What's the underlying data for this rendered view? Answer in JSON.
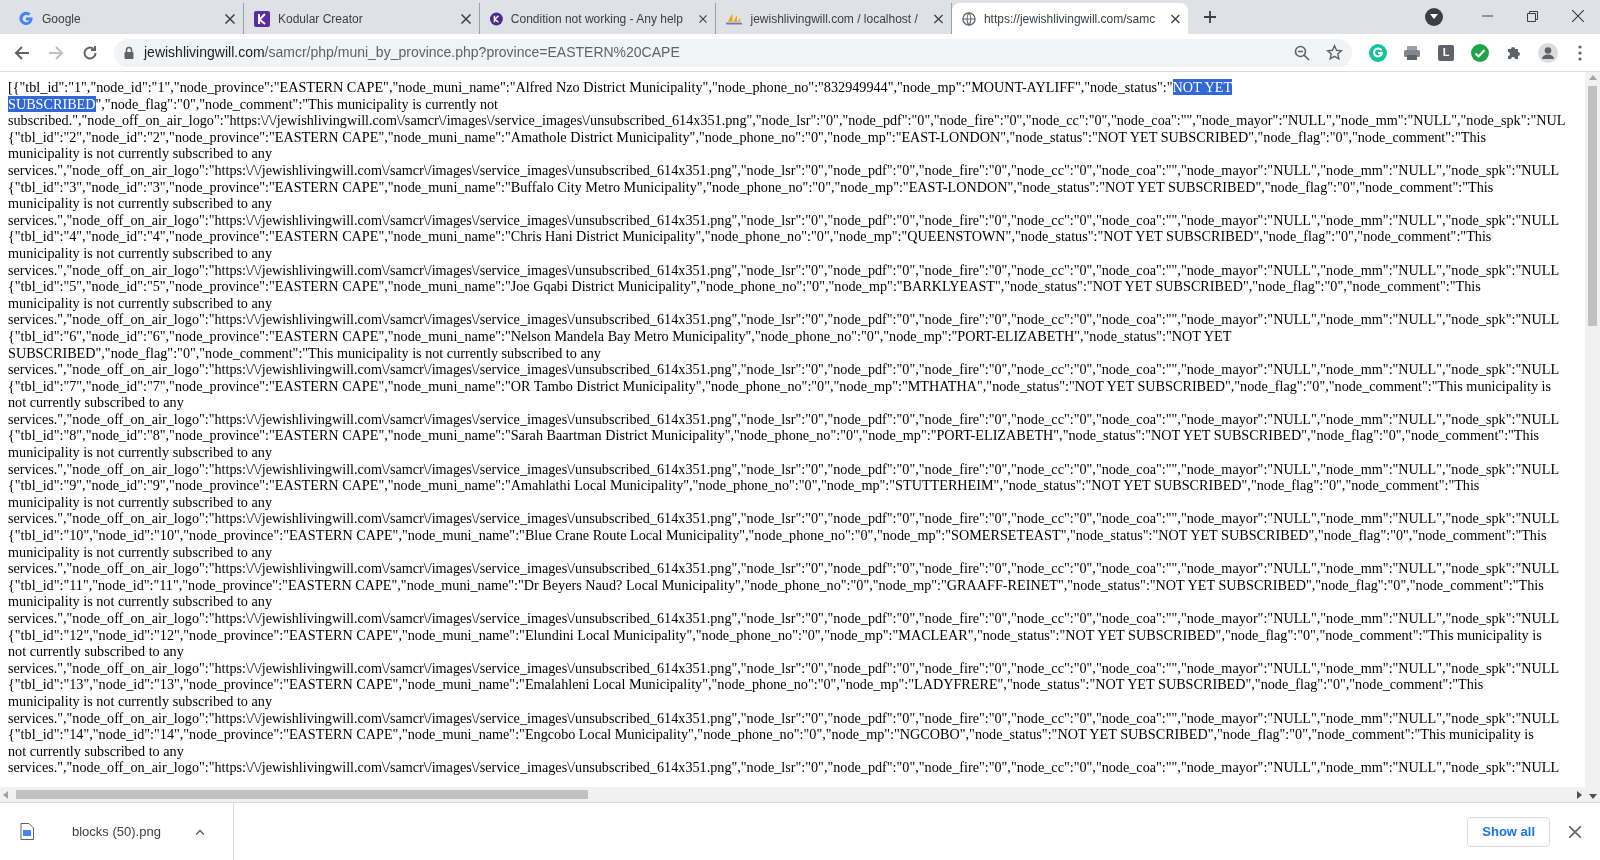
{
  "tabs": [
    {
      "title": "Google",
      "kind": "google",
      "selected": false
    },
    {
      "title": "Kodular Creator",
      "kind": "kodular-square",
      "selected": false
    },
    {
      "title": "Condition not working - Any help",
      "kind": "kodular-circle",
      "selected": false
    },
    {
      "title": "jewishlivingwill.com / localhost /",
      "kind": "pma",
      "selected": false
    },
    {
      "title": "https://jewishlivingwill.com/samc",
      "kind": "globe",
      "selected": true
    }
  ],
  "address_bar": {
    "domain": "jewishlivingwill.com",
    "path": "/samcr/php/muni_by_province.php?province=EASTERN%20CAPE"
  },
  "extension_letter": "L",
  "lines": [
    [
      {
        "text": "[{\"tbl_id\":\"1\",\"node_id\":\"1\",\"node_province\":\"EASTERN CAPE\",\"node_muni_name\":\"Alfred Nzo District Municipality\",\"node_phone_no\":\"832949944\",\"node_mp\":\"MOUNT-AYLIFF\",\"node_status\":\"",
        "selected": false
      },
      {
        "text": "NOT YET",
        "selected": true
      }
    ],
    [
      {
        "text": "SUBSCRIBED",
        "selected": true
      },
      {
        "text": "\",\"node_flag\":\"0\",\"node_comment\":\"This municipality is currently not",
        "selected": false
      }
    ],
    [
      {
        "text": "subscribed.\",\"node_off_on_air_logo\":\"https:\\/\\/jewishlivingwill.com\\/samcr\\/images\\/service_images\\/unsubscribed_614x351.png\",\"node_lsr\":\"0\",\"node_pdf\":\"0\",\"node_fire\":\"0\",\"node_cc\":\"0\",\"node_coa\":\"\",\"node_mayor\":\"NULL\",\"node_mm\":\"NULL\",\"node_spk\":\"NUL",
        "selected": false
      }
    ],
    [
      {
        "text": "{\"tbl_id\":\"2\",\"node_id\":\"2\",\"node_province\":\"EASTERN CAPE\",\"node_muni_name\":\"Amathole District Municipality\",\"node_phone_no\":\"0\",\"node_mp\":\"EAST-LONDON\",\"node_status\":\"NOT YET SUBSCRIBED\",\"node_flag\":\"0\",\"node_comment\":\"This",
        "selected": false
      }
    ],
    [
      {
        "text": "municipality is not currently subscribed to any",
        "selected": false
      }
    ],
    [
      {
        "text": "services.\",\"node_off_on_air_logo\":\"https:\\/\\/jewishlivingwill.com\\/samcr\\/images\\/service_images\\/unsubscribed_614x351.png\",\"node_lsr\":\"0\",\"node_pdf\":\"0\",\"node_fire\":\"0\",\"node_cc\":\"0\",\"node_coa\":\"\",\"node_mayor\":\"NULL\",\"node_mm\":\"NULL\",\"node_spk\":\"NULL",
        "selected": false
      }
    ],
    [
      {
        "text": "{\"tbl_id\":\"3\",\"node_id\":\"3\",\"node_province\":\"EASTERN CAPE\",\"node_muni_name\":\"Buffalo City Metro Municipality\",\"node_phone_no\":\"0\",\"node_mp\":\"EAST-LONDON\",\"node_status\":\"NOT YET SUBSCRIBED\",\"node_flag\":\"0\",\"node_comment\":\"This",
        "selected": false
      }
    ],
    [
      {
        "text": "municipality is not currently subscribed to any",
        "selected": false
      }
    ],
    [
      {
        "text": "services.\",\"node_off_on_air_logo\":\"https:\\/\\/jewishlivingwill.com\\/samcr\\/images\\/service_images\\/unsubscribed_614x351.png\",\"node_lsr\":\"0\",\"node_pdf\":\"0\",\"node_fire\":\"0\",\"node_cc\":\"0\",\"node_coa\":\"\",\"node_mayor\":\"NULL\",\"node_mm\":\"NULL\",\"node_spk\":\"NULL",
        "selected": false
      }
    ],
    [
      {
        "text": "{\"tbl_id\":\"4\",\"node_id\":\"4\",\"node_province\":\"EASTERN CAPE\",\"node_muni_name\":\"Chris Hani District Municipality\",\"node_phone_no\":\"0\",\"node_mp\":\"QUEENSTOWN\",\"node_status\":\"NOT YET SUBSCRIBED\",\"node_flag\":\"0\",\"node_comment\":\"This",
        "selected": false
      }
    ],
    [
      {
        "text": "municipality is not currently subscribed to any",
        "selected": false
      }
    ],
    [
      {
        "text": "services.\",\"node_off_on_air_logo\":\"https:\\/\\/jewishlivingwill.com\\/samcr\\/images\\/service_images\\/unsubscribed_614x351.png\",\"node_lsr\":\"0\",\"node_pdf\":\"0\",\"node_fire\":\"0\",\"node_cc\":\"0\",\"node_coa\":\"\",\"node_mayor\":\"NULL\",\"node_mm\":\"NULL\",\"node_spk\":\"NULL",
        "selected": false
      }
    ],
    [
      {
        "text": "{\"tbl_id\":\"5\",\"node_id\":\"5\",\"node_province\":\"EASTERN CAPE\",\"node_muni_name\":\"Joe Gqabi District Municipality\",\"node_phone_no\":\"0\",\"node_mp\":\"BARKLYEAST\",\"node_status\":\"NOT YET SUBSCRIBED\",\"node_flag\":\"0\",\"node_comment\":\"This",
        "selected": false
      }
    ],
    [
      {
        "text": "municipality is not currently subscribed to any",
        "selected": false
      }
    ],
    [
      {
        "text": "services.\",\"node_off_on_air_logo\":\"https:\\/\\/jewishlivingwill.com\\/samcr\\/images\\/service_images\\/unsubscribed_614x351.png\",\"node_lsr\":\"0\",\"node_pdf\":\"0\",\"node_fire\":\"0\",\"node_cc\":\"0\",\"node_coa\":\"\",\"node_mayor\":\"NULL\",\"node_mm\":\"NULL\",\"node_spk\":\"NULL",
        "selected": false
      }
    ],
    [
      {
        "text": "{\"tbl_id\":\"6\",\"node_id\":\"6\",\"node_province\":\"EASTERN CAPE\",\"node_muni_name\":\"Nelson Mandela Bay Metro Municipality\",\"node_phone_no\":\"0\",\"node_mp\":\"PORT-ELIZABETH\",\"node_status\":\"NOT YET",
        "selected": false
      }
    ],
    [
      {
        "text": "SUBSCRIBED\",\"node_flag\":\"0\",\"node_comment\":\"This municipality is not currently subscribed to any",
        "selected": false
      }
    ],
    [
      {
        "text": "services.\",\"node_off_on_air_logo\":\"https:\\/\\/jewishlivingwill.com\\/samcr\\/images\\/service_images\\/unsubscribed_614x351.png\",\"node_lsr\":\"0\",\"node_pdf\":\"0\",\"node_fire\":\"0\",\"node_cc\":\"0\",\"node_coa\":\"\",\"node_mayor\":\"NULL\",\"node_mm\":\"NULL\",\"node_spk\":\"NULL",
        "selected": false
      }
    ],
    [
      {
        "text": "{\"tbl_id\":\"7\",\"node_id\":\"7\",\"node_province\":\"EASTERN CAPE\",\"node_muni_name\":\"OR Tambo District Municipality\",\"node_phone_no\":\"0\",\"node_mp\":\"MTHATHA\",\"node_status\":\"NOT YET SUBSCRIBED\",\"node_flag\":\"0\",\"node_comment\":\"This municipality is",
        "selected": false
      }
    ],
    [
      {
        "text": "not currently subscribed to any",
        "selected": false
      }
    ],
    [
      {
        "text": "services.\",\"node_off_on_air_logo\":\"https:\\/\\/jewishlivingwill.com\\/samcr\\/images\\/service_images\\/unsubscribed_614x351.png\",\"node_lsr\":\"0\",\"node_pdf\":\"0\",\"node_fire\":\"0\",\"node_cc\":\"0\",\"node_coa\":\"\",\"node_mayor\":\"NULL\",\"node_mm\":\"NULL\",\"node_spk\":\"NULL",
        "selected": false
      }
    ],
    [
      {
        "text": "{\"tbl_id\":\"8\",\"node_id\":\"8\",\"node_province\":\"EASTERN CAPE\",\"node_muni_name\":\"Sarah Baartman District Municipality\",\"node_phone_no\":\"0\",\"node_mp\":\"PORT-ELIZABETH\",\"node_status\":\"NOT YET SUBSCRIBED\",\"node_flag\":\"0\",\"node_comment\":\"This",
        "selected": false
      }
    ],
    [
      {
        "text": "municipality is not currently subscribed to any",
        "selected": false
      }
    ],
    [
      {
        "text": "services.\",\"node_off_on_air_logo\":\"https:\\/\\/jewishlivingwill.com\\/samcr\\/images\\/service_images\\/unsubscribed_614x351.png\",\"node_lsr\":\"0\",\"node_pdf\":\"0\",\"node_fire\":\"0\",\"node_cc\":\"0\",\"node_coa\":\"\",\"node_mayor\":\"NULL\",\"node_mm\":\"NULL\",\"node_spk\":\"NULL",
        "selected": false
      }
    ],
    [
      {
        "text": "{\"tbl_id\":\"9\",\"node_id\":\"9\",\"node_province\":\"EASTERN CAPE\",\"node_muni_name\":\"Amahlathi Local Municipality\",\"node_phone_no\":\"0\",\"node_mp\":\"STUTTERHEIM\",\"node_status\":\"NOT YET SUBSCRIBED\",\"node_flag\":\"0\",\"node_comment\":\"This",
        "selected": false
      }
    ],
    [
      {
        "text": "municipality is not currently subscribed to any",
        "selected": false
      }
    ],
    [
      {
        "text": "services.\",\"node_off_on_air_logo\":\"https:\\/\\/jewishlivingwill.com\\/samcr\\/images\\/service_images\\/unsubscribed_614x351.png\",\"node_lsr\":\"0\",\"node_pdf\":\"0\",\"node_fire\":\"0\",\"node_cc\":\"0\",\"node_coa\":\"\",\"node_mayor\":\"NULL\",\"node_mm\":\"NULL\",\"node_spk\":\"NULL",
        "selected": false
      }
    ],
    [
      {
        "text": "{\"tbl_id\":\"10\",\"node_id\":\"10\",\"node_province\":\"EASTERN CAPE\",\"node_muni_name\":\"Blue Crane Route Local Municipality\",\"node_phone_no\":\"0\",\"node_mp\":\"SOMERSETEAST\",\"node_status\":\"NOT YET SUBSCRIBED\",\"node_flag\":\"0\",\"node_comment\":\"This",
        "selected": false
      }
    ],
    [
      {
        "text": "municipality is not currently subscribed to any",
        "selected": false
      }
    ],
    [
      {
        "text": "services.\",\"node_off_on_air_logo\":\"https:\\/\\/jewishlivingwill.com\\/samcr\\/images\\/service_images\\/unsubscribed_614x351.png\",\"node_lsr\":\"0\",\"node_pdf\":\"0\",\"node_fire\":\"0\",\"node_cc\":\"0\",\"node_coa\":\"\",\"node_mayor\":\"NULL\",\"node_mm\":\"NULL\",\"node_spk\":\"NULL",
        "selected": false
      }
    ],
    [
      {
        "text": "{\"tbl_id\":\"11\",\"node_id\":\"11\",\"node_province\":\"EASTERN CAPE\",\"node_muni_name\":\"Dr Beyers Naud? Local Municipality\",\"node_phone_no\":\"0\",\"node_mp\":\"GRAAFF-REINET\",\"node_status\":\"NOT YET SUBSCRIBED\",\"node_flag\":\"0\",\"node_comment\":\"This",
        "selected": false
      }
    ],
    [
      {
        "text": "municipality is not currently subscribed to any",
        "selected": false
      }
    ],
    [
      {
        "text": "services.\",\"node_off_on_air_logo\":\"https:\\/\\/jewishlivingwill.com\\/samcr\\/images\\/service_images\\/unsubscribed_614x351.png\",\"node_lsr\":\"0\",\"node_pdf\":\"0\",\"node_fire\":\"0\",\"node_cc\":\"0\",\"node_coa\":\"\",\"node_mayor\":\"NULL\",\"node_mm\":\"NULL\",\"node_spk\":\"NULL",
        "selected": false
      }
    ],
    [
      {
        "text": "{\"tbl_id\":\"12\",\"node_id\":\"12\",\"node_province\":\"EASTERN CAPE\",\"node_muni_name\":\"Elundini Local Municipality\",\"node_phone_no\":\"0\",\"node_mp\":\"MACLEAR\",\"node_status\":\"NOT YET SUBSCRIBED\",\"node_flag\":\"0\",\"node_comment\":\"This municipality is",
        "selected": false
      }
    ],
    [
      {
        "text": "not currently subscribed to any",
        "selected": false
      }
    ],
    [
      {
        "text": "services.\",\"node_off_on_air_logo\":\"https:\\/\\/jewishlivingwill.com\\/samcr\\/images\\/service_images\\/unsubscribed_614x351.png\",\"node_lsr\":\"0\",\"node_pdf\":\"0\",\"node_fire\":\"0\",\"node_cc\":\"0\",\"node_coa\":\"\",\"node_mayor\":\"NULL\",\"node_mm\":\"NULL\",\"node_spk\":\"NULL",
        "selected": false
      }
    ],
    [
      {
        "text": "{\"tbl_id\":\"13\",\"node_id\":\"13\",\"node_province\":\"EASTERN CAPE\",\"node_muni_name\":\"Emalahleni Local Municipality\",\"node_phone_no\":\"0\",\"node_mp\":\"LADYFRERE\",\"node_status\":\"NOT YET SUBSCRIBED\",\"node_flag\":\"0\",\"node_comment\":\"This",
        "selected": false
      }
    ],
    [
      {
        "text": "municipality is not currently subscribed to any",
        "selected": false
      }
    ],
    [
      {
        "text": "services.\",\"node_off_on_air_logo\":\"https:\\/\\/jewishlivingwill.com\\/samcr\\/images\\/service_images\\/unsubscribed_614x351.png\",\"node_lsr\":\"0\",\"node_pdf\":\"0\",\"node_fire\":\"0\",\"node_cc\":\"0\",\"node_coa\":\"\",\"node_mayor\":\"NULL\",\"node_mm\":\"NULL\",\"node_spk\":\"NULL",
        "selected": false
      }
    ],
    [
      {
        "text": "{\"tbl_id\":\"14\",\"node_id\":\"14\",\"node_province\":\"EASTERN CAPE\",\"node_muni_name\":\"Engcobo Local Municipality\",\"node_phone_no\":\"0\",\"node_mp\":\"NGCOBO\",\"node_status\":\"NOT YET SUBSCRIBED\",\"node_flag\":\"0\",\"node_comment\":\"This municipality is",
        "selected": false
      }
    ],
    [
      {
        "text": "not currently subscribed to any",
        "selected": false
      }
    ],
    [
      {
        "text": "services.\",\"node_off_on_air_logo\":\"https:\\/\\/jewishlivingwill.com\\/samcr\\/images\\/service_images\\/unsubscribed_614x351.png\",\"node_lsr\":\"0\",\"node_pdf\":\"0\",\"node_fire\":\"0\",\"node_cc\":\"0\",\"node_coa\":\"\",\"node_mayor\":\"NULL\",\"node_mm\":\"NULL\",\"node_spk\":\"NULL",
        "selected": false
      }
    ]
  ],
  "download": {
    "file_name": "blocks (50).png",
    "show_all": "Show all"
  }
}
